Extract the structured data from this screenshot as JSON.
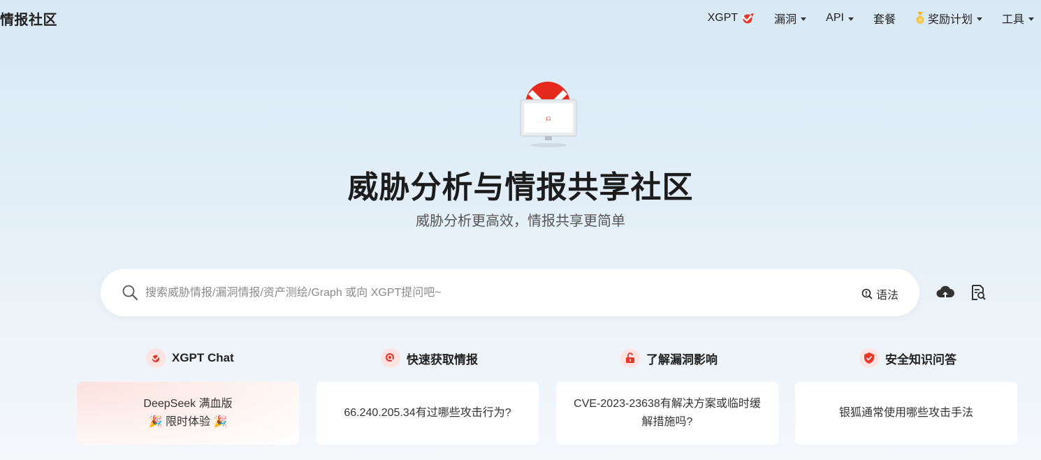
{
  "header": {
    "brand": "情报社区",
    "nav": [
      {
        "label": "XGPT",
        "icon": "xgpt-logo-icon",
        "caret": false
      },
      {
        "label": "漏洞",
        "caret": true
      },
      {
        "label": "API",
        "caret": true
      },
      {
        "label": "套餐",
        "caret": false
      },
      {
        "label": "奖励计划",
        "icon": "medal-icon",
        "caret": true
      },
      {
        "label": "工具",
        "caret": true
      }
    ]
  },
  "hero": {
    "title": "威胁分析与情报共享社区",
    "subtitle": "威胁分析更高效，情报共享更简单"
  },
  "search": {
    "placeholder": "搜索威胁情报/漏洞情报/资产测绘/Graph 或向 XGPT提问吧~",
    "value": "",
    "syntax_label": "语法"
  },
  "categories": [
    {
      "title": "XGPT Chat",
      "icon": "xgpt-logo-icon",
      "card_lines": [
        "DeepSeek 满血版",
        "🎉 限时体验 🎉"
      ]
    },
    {
      "title": "快速获取情报",
      "icon": "search-intel-icon",
      "card_lines": [
        "66.240.205.34有过哪些攻击行为?"
      ]
    },
    {
      "title": "了解漏洞影响",
      "icon": "unlock-icon",
      "card_lines": [
        "CVE-2023-23638有解决方案或临时缓",
        "解措施吗?"
      ]
    },
    {
      "title": "安全知识问答",
      "icon": "shield-icon",
      "card_lines": [
        "银狐通常使用哪些攻击手法"
      ]
    }
  ],
  "colors": {
    "accent": "#e8382b",
    "icon_bg": "#fde3e1",
    "text": "#222222",
    "muted": "#8a8a8a"
  }
}
